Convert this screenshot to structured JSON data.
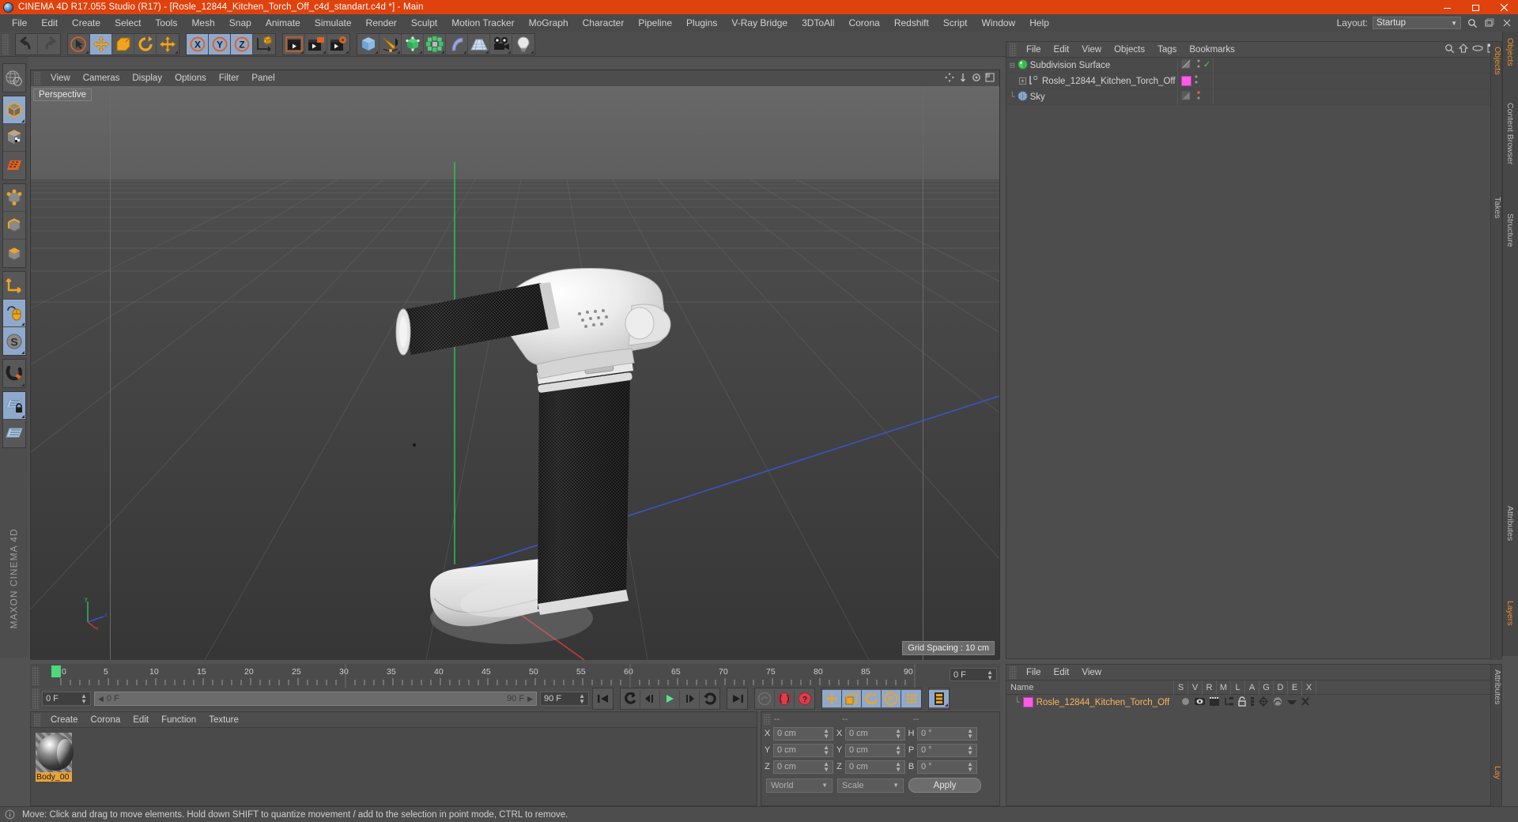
{
  "window": {
    "title": "CINEMA 4D R17.055 Studio (R17) - [Rosle_12844_Kitchen_Torch_Off_c4d_standart.c4d *] - Main",
    "minimize": "minimize-icon",
    "maximize": "maximize-icon",
    "close": "close-icon"
  },
  "menubar": {
    "items": [
      "File",
      "Edit",
      "Create",
      "Select",
      "Tools",
      "Mesh",
      "Snap",
      "Animate",
      "Simulate",
      "Render",
      "Sculpt",
      "Motion Tracker",
      "MoGraph",
      "Character",
      "Pipeline",
      "Plugins",
      "V-Ray Bridge",
      "3DToAll",
      "Corona",
      "Redshift",
      "Script",
      "Window",
      "Help"
    ],
    "layout_label": "Layout:",
    "layout_value": "Startup"
  },
  "viewport": {
    "menu": [
      "View",
      "Cameras",
      "Display",
      "Options",
      "Filter",
      "Panel"
    ],
    "tab": "Perspective",
    "grid_spacing": "Grid Spacing : 10 cm",
    "axis": {
      "x": "x",
      "y": "y",
      "z": "z"
    }
  },
  "object_manager": {
    "menu": [
      "File",
      "Edit",
      "View",
      "Objects",
      "Tags",
      "Bookmarks"
    ],
    "rows": [
      {
        "name": "Subdivision Surface",
        "indent": 0,
        "color": "#4ccf62",
        "selected": false,
        "tag": "none",
        "check": "✓"
      },
      {
        "name": "Rosle_12844_Kitchen_Torch_Off",
        "indent": 1,
        "color": "#ff5ae8",
        "selected": false,
        "tag": "magenta",
        "check": ""
      },
      {
        "name": "Sky",
        "indent": 0,
        "color": "#93b6d8",
        "selected": false,
        "tag": "none",
        "check": ""
      }
    ],
    "side_tabs": [
      "Objects",
      "Takes"
    ]
  },
  "timeline": {
    "ticks": [
      0,
      5,
      10,
      15,
      20,
      25,
      30,
      35,
      40,
      45,
      50,
      55,
      60,
      65,
      70,
      75,
      80,
      85,
      90
    ],
    "current_frame": "0 F",
    "frame_field_left": "0 F",
    "range_start": "0 F",
    "range_end": "90 F",
    "range_field": "90 F"
  },
  "transport": {
    "buttons": [
      "go-to-start",
      "play-backward",
      "step-backward",
      "play-forward",
      "step-forward",
      "loop",
      "go-to-end",
      "record-auto",
      "record-position",
      "record-question",
      "key-move",
      "key-scale",
      "key-rotate",
      "key-param",
      "key-points",
      "timeline-toggle"
    ]
  },
  "material_manager": {
    "menu": [
      "Create",
      "Corona",
      "Edit",
      "Function",
      "Texture"
    ],
    "materials": [
      {
        "name": "Body_00"
      }
    ]
  },
  "coordinates": {
    "headers": [
      "--",
      "--",
      "--"
    ],
    "rows": [
      {
        "label": "X",
        "pos": "0 cm",
        "label2": "X",
        "size": "0 cm",
        "label3": "H",
        "rot": "0 °"
      },
      {
        "label": "Y",
        "pos": "0 cm",
        "label2": "Y",
        "size": "0 cm",
        "label3": "P",
        "rot": "0 °"
      },
      {
        "label": "Z",
        "pos": "0 cm",
        "label2": "Z",
        "size": "0 cm",
        "label3": "B",
        "rot": "0 °"
      }
    ],
    "coord_system": "World",
    "mode": "Scale",
    "apply": "Apply"
  },
  "attributes": {
    "menu": [
      "File",
      "Edit",
      "View"
    ],
    "columns": [
      "Name",
      "S",
      "V",
      "R",
      "M",
      "L",
      "A",
      "G",
      "D",
      "E",
      "X"
    ],
    "rows": [
      {
        "name": "Rosle_12844_Kitchen_Torch_Off",
        "color": "#ff5ae8"
      }
    ],
    "side_tabs": [
      "Attributes",
      "Lay"
    ]
  },
  "statusbar": {
    "text": "Move: Click and drag to move elements. Hold down SHIFT to quantize movement / add to the selection in point mode, CTRL to remove."
  },
  "left_palette": {
    "items": [
      "undo-redo-world-icon",
      "selection-cube-icon",
      "texture-cube-icon",
      "polygon-grid-icon",
      "points-mode-icon",
      "edges-mode-icon",
      "polygons-mode-icon",
      "axis-modify-icon",
      "enable-axis-icon",
      "snap-s-icon",
      "magnet-icon",
      "workplane-lock-icon",
      "workplane-icon"
    ]
  },
  "toolbar": {
    "groups": [
      [
        "undo-icon",
        "redo-icon"
      ],
      [
        "select-live-icon",
        "move-icon",
        "scale-icon",
        "rotate-icon",
        "move-world-icon"
      ],
      [
        "axis-x-icon",
        "axis-y-icon",
        "axis-z-icon",
        "world-object-axis-icon"
      ],
      [
        "render-view-icon",
        "render-to-picture-icon",
        "render-settings-icon"
      ],
      [
        "cube-primitive-icon",
        "spline-pen-icon",
        "nurbs-icon",
        "array-icon",
        "bend-deformer-icon",
        "floor-icon",
        "camera-icon",
        "light-icon"
      ]
    ]
  },
  "side_edge_tabs": [
    "Objects",
    "Content Browser",
    "Structure",
    "Attributes",
    "Layers"
  ],
  "branding": "MAXON CINEMA 4D",
  "colors": {
    "title_bar": "#e0420d",
    "panel_bg": "#4d4d4d",
    "panel_dark": "#3f3f3f",
    "accent_orange": "#ff9e1b",
    "selected_blue": "#8fa9cd",
    "selected_text": "#ffb45a",
    "material_label": "#e8a33a"
  }
}
